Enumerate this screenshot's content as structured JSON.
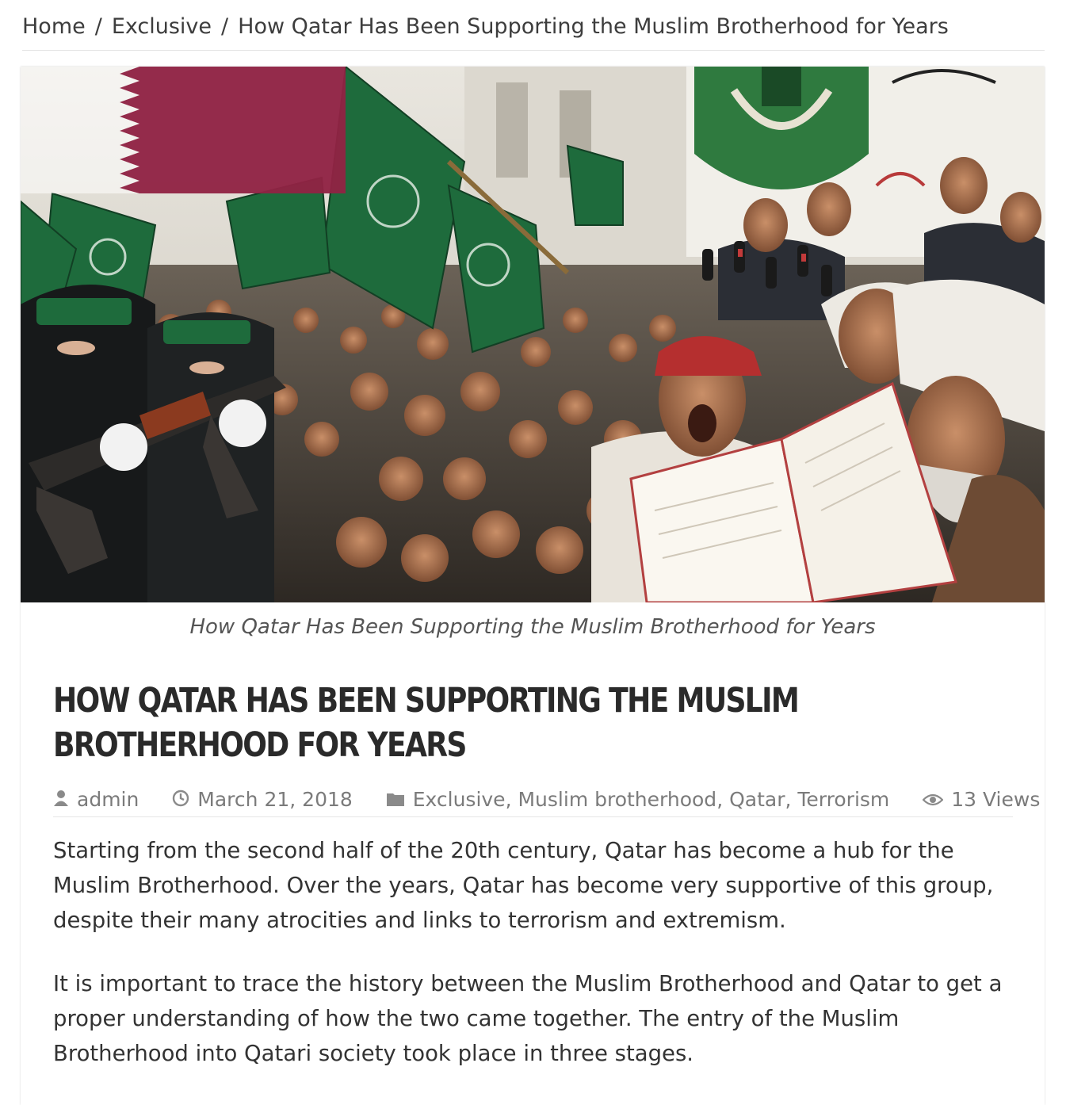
{
  "breadcrumb": {
    "home": "Home",
    "separator": "/",
    "category": "Exclusive",
    "current": "How Qatar Has Been Supporting the Muslim Brotherhood for Years"
  },
  "article": {
    "image_caption": "How Qatar Has Been Supporting the Muslim Brotherhood for Years",
    "title": "How Qatar Has Been Supporting the Muslim Brotherhood for Years",
    "meta": {
      "author": "admin",
      "date": "March 21, 2018",
      "categories": [
        "Exclusive",
        "Muslim brotherhood",
        "Qatar",
        "Terrorism"
      ],
      "category_separator": ", ",
      "views": "13 Views"
    },
    "paragraphs": [
      "Starting from the second half of the 20th century, Qatar has become a hub for the Muslim Brotherhood. Over the years, Qatar has become very supportive of this group, despite their many atrocities and links to terrorism and extremism.",
      "It is important to trace the history between the Muslim Brotherhood and Qatar to get a proper understanding of how the two came together. The entry of the Muslim Brotherhood into Qatari society took place in three stages."
    ]
  },
  "icons": {
    "author": "user-icon",
    "date": "clock-icon",
    "categories": "folder-icon",
    "views": "eye-icon"
  },
  "colors": {
    "qatar_maroon": "#8a1538",
    "flag_green": "#1e6b3c",
    "text": "#333333",
    "meta_text": "#7b7b7b"
  }
}
